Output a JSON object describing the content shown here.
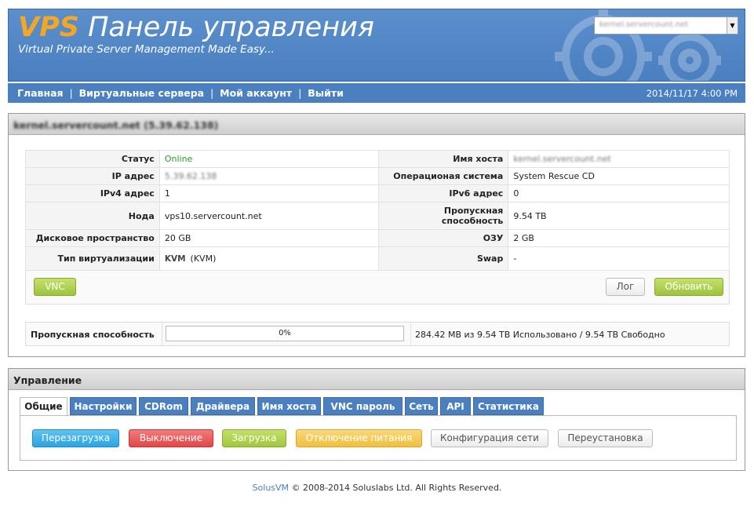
{
  "header": {
    "brand_vps": "VPS",
    "brand_title": "Панель управления",
    "tagline": "Virtual Private Server Management Made Easy...",
    "server_select": "kernel.servercount.net"
  },
  "nav": {
    "items": [
      "Главная",
      "Виртуальные сервера",
      "Мой аккаунт",
      "Выйти"
    ],
    "separator": "|",
    "date": "2014/11/17 4:00 PM"
  },
  "server": {
    "title": "kernel.servercount.net (5.39.62.138)",
    "rows": [
      {
        "l1": "Статус",
        "v1": "Online",
        "l2": "Имя хоста",
        "v2": "kernel.servercount.net"
      },
      {
        "l1": "IP адрес",
        "v1": "5.39.62.138",
        "l2": "Операционая система",
        "v2": "System Rescue CD"
      },
      {
        "l1": "IPv4 адрес",
        "v1": "1",
        "l2": "IPv6 адрес",
        "v2": "0"
      },
      {
        "l1": "Нода",
        "v1": "vps10.servercount.net",
        "l2": "Пропускная способность",
        "v2": "9.54 TB"
      },
      {
        "l1": "Дисковое пространство",
        "v1": "20 GB",
        "l2": "ОЗУ",
        "v2": "2 GB"
      },
      {
        "l1": "Тип виртуализации",
        "v1": "(KVM)",
        "v1_logo": "KVM",
        "l2": "Swap",
        "v2": "-"
      }
    ],
    "buttons": {
      "vnc": "VNC",
      "log": "Лог",
      "refresh": "Обновить"
    },
    "bandwidth": {
      "label": "Пропускная способность",
      "percent": 0,
      "percent_text": "0%",
      "usage_text": "284.42 MB из 9.54 TB Использовано / 9.54 TB Свободно"
    }
  },
  "management": {
    "title": "Управление",
    "tabs": [
      "Общие",
      "Настройки",
      "CDRom",
      "Драйвера",
      "Имя хоста",
      "VNC пароль",
      "Сеть",
      "API",
      "Статистика"
    ],
    "active_tab": 0,
    "actions": [
      "Перезагрузка",
      "Выключение",
      "Загрузка",
      "Отключение питания",
      "Конфигурация сети",
      "Переустановка"
    ]
  },
  "footer": {
    "link": "SolusVM",
    "copyright": "© 2008-2014 Soluslabs Ltd. All Rights Reserved."
  },
  "colors": {
    "header_blue": "#4a7fc0",
    "brand_orange": "#f5a623",
    "online_green": "#2a9a2a"
  }
}
